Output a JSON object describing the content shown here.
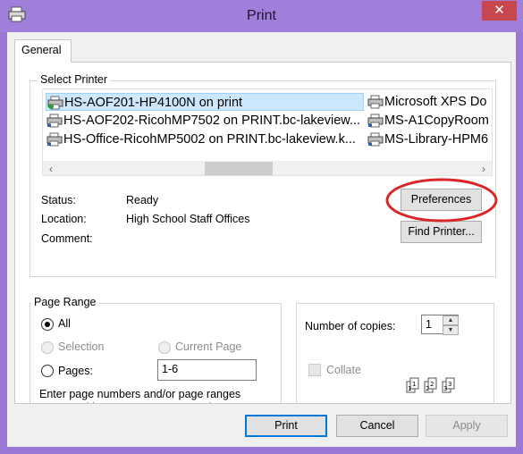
{
  "window": {
    "title": "Print",
    "close_glyph": "✕"
  },
  "tabs": {
    "general": "General"
  },
  "select_printer": {
    "title": "Select Printer",
    "printers": [
      {
        "name": "HS-AOF201-HP4100N on print",
        "icon": "printer-icon",
        "selected": true
      },
      {
        "name": "HS-AOF202-RicohMP7502 on PRINT.bc-lakeview...",
        "icon": "printer-icon"
      },
      {
        "name": "HS-Office-RicohMP5002 on PRINT.bc-lakeview.k...",
        "icon": "printer-icon"
      },
      {
        "name": "Microsoft XPS Do",
        "icon": "printer-icon"
      },
      {
        "name": "MS-A1CopyRoom",
        "icon": "printer-icon"
      },
      {
        "name": "MS-Library-HPM6",
        "icon": "printer-icon"
      }
    ],
    "scroll_left": "‹",
    "scroll_right": "›",
    "status_label": "Status:",
    "status_value": "Ready",
    "location_label": "Location:",
    "location_value": "High School Staff Offices",
    "comment_label": "Comment:",
    "preferences_button": "Preferences",
    "find_printer_button": "Find Printer...",
    "highlight_color": "#d9262a"
  },
  "page_range": {
    "title": "Page Range",
    "all": "All",
    "selection": "Selection",
    "current_page": "Current Page",
    "pages": "Pages:",
    "pages_value": "1-6",
    "description": "Enter page numbers and/or page ranges separated by commas.  For example,"
  },
  "copies": {
    "label": "Number of copies:",
    "value": "1",
    "collate": "Collate"
  },
  "buttons": {
    "print": "Print",
    "cancel": "Cancel",
    "apply": "Apply"
  }
}
